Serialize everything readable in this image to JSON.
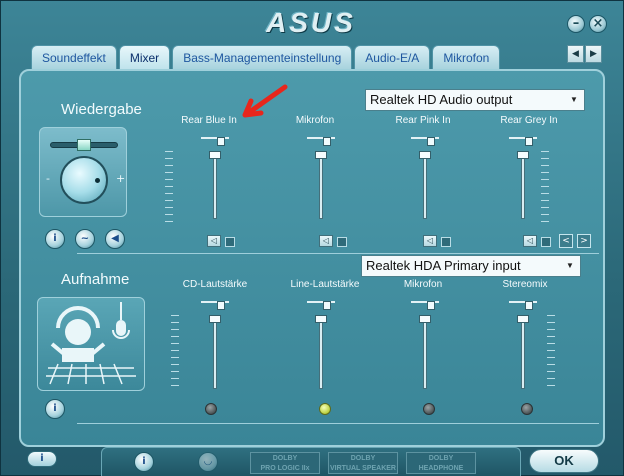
{
  "header": {
    "logo": "ASUS"
  },
  "window_controls": {
    "minimize": "–",
    "close": "×"
  },
  "tabs": [
    {
      "label": "Soundeffekt"
    },
    {
      "label": "Mixer"
    },
    {
      "label": "Bass-Managementeinstellung"
    },
    {
      "label": "Audio-E/A"
    },
    {
      "label": "Mikrofon"
    }
  ],
  "tab_nav": {
    "prev": "◀",
    "next": "▶"
  },
  "playback": {
    "title": "Wiedergabe",
    "device": "Realtek HD Audio output",
    "knob": {
      "minus": "-",
      "plus": "+"
    },
    "channels": [
      {
        "label": "Rear Blue In"
      },
      {
        "label": "Mikrofon"
      },
      {
        "label": "Rear Pink In"
      },
      {
        "label": "Rear Grey In"
      }
    ]
  },
  "recording": {
    "title": "Aufnahme",
    "device": "Realtek HDA Primary input",
    "channels": [
      {
        "label": "CD-Lautstärke"
      },
      {
        "label": "Line-Lautstärke"
      },
      {
        "label": "Mikrofon"
      },
      {
        "label": "Stereomix"
      }
    ]
  },
  "footer": {
    "dolby": [
      {
        "line1": "DOLBY",
        "line2": "PRO LOGIC IIx"
      },
      {
        "line1": "DOLBY",
        "line2": "VIRTUAL SPEAKER"
      },
      {
        "line1": "DOLBY",
        "line2": "HEADPHONE"
      }
    ],
    "ok": "OK"
  },
  "colors": {
    "accent_arrow": "#e8261c",
    "led_on": "#c8dd4a"
  }
}
